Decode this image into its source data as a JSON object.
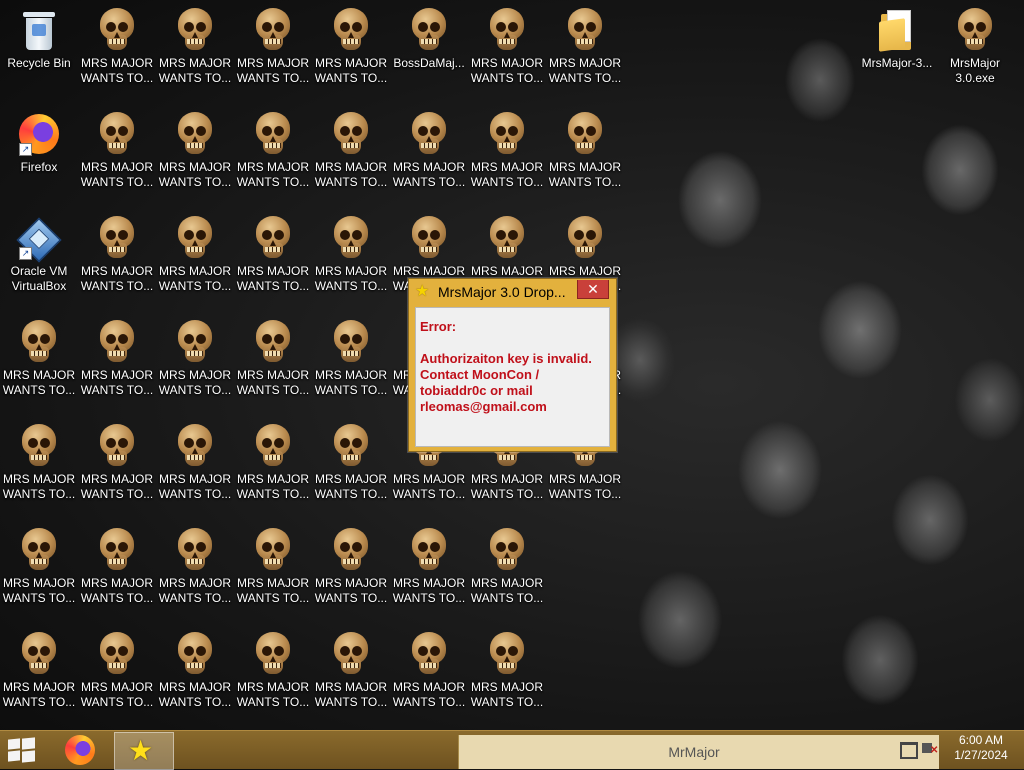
{
  "desktop": {
    "icons": {
      "recycle_bin": "Recycle Bin",
      "firefox": "Firefox",
      "virtualbox": "Oracle VM\nVirtualBox",
      "boss": "BossDaMaj...",
      "folder": "MrsMajor-3...",
      "exe": "MrsMajor\n3.0.exe",
      "skull_label": "MRS MAJOR\nWANTS TO..."
    }
  },
  "dialog": {
    "title": "MrsMajor 3.0 Drop...",
    "close": "✕",
    "error_label": "Error:",
    "message": "Authorizaiton key is invalid.\nContact MoonCon / tobiaddr0c or mail rleomas@gmail.com"
  },
  "taskbar": {
    "window_title": "MrMajor",
    "time": "6:00 AM",
    "date": "1/27/2024"
  }
}
